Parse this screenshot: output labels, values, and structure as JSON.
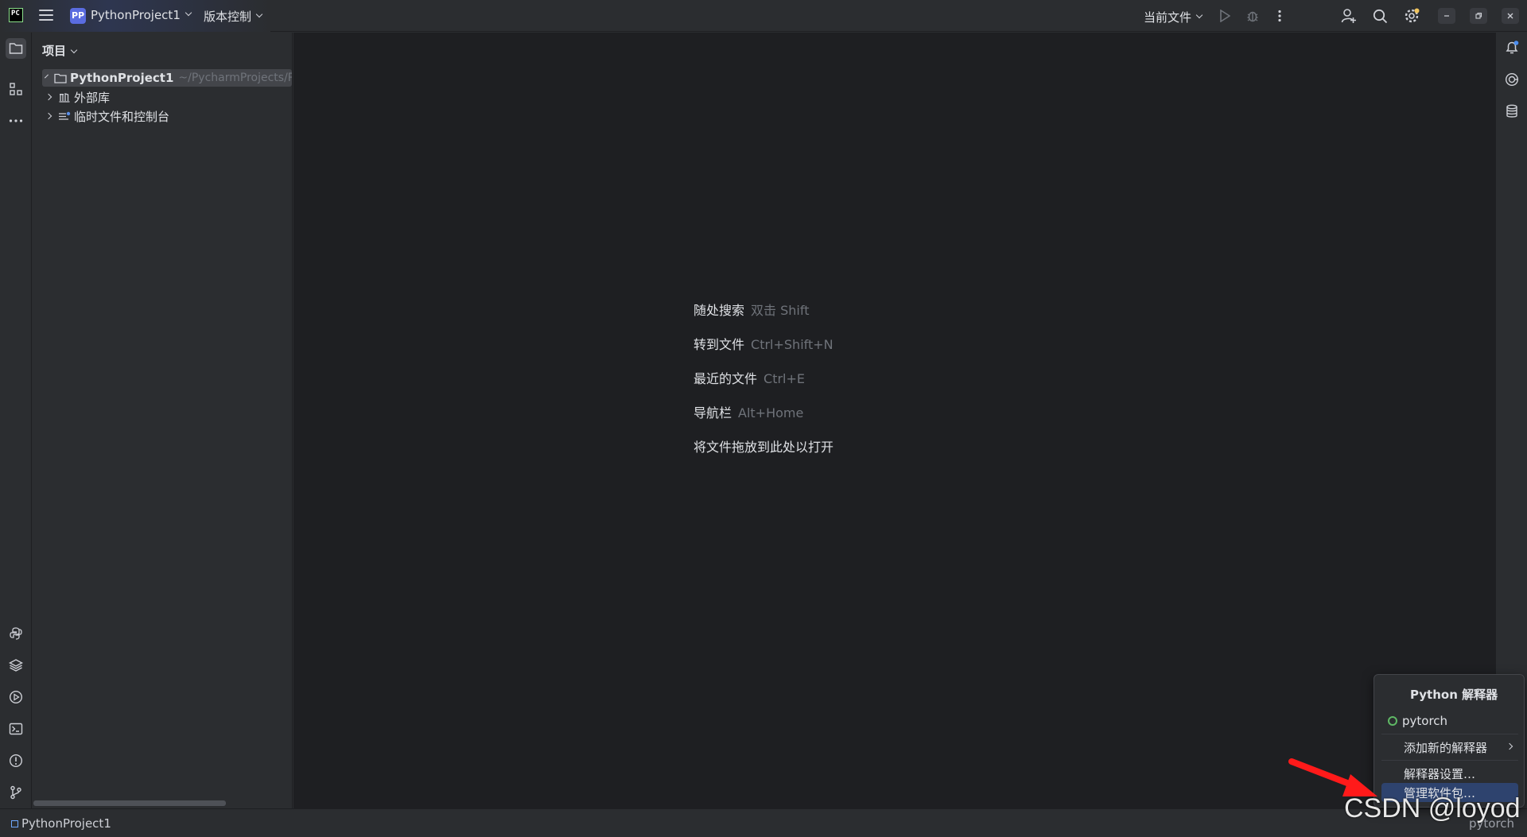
{
  "titlebar": {
    "app_icon": "pycharm-logo-icon",
    "project_badge": "PP",
    "project_name": "PythonProject1",
    "vcs_label": "版本控制",
    "run_config": "当前文件",
    "icons": [
      "menu-icon",
      "run-icon",
      "debug-icon",
      "more-vertical-icon",
      "add-user-icon",
      "search-icon",
      "settings-icon",
      "minimize-icon",
      "restore-icon",
      "close-icon"
    ]
  },
  "left_strip": {
    "top_icons": [
      "project-folder-icon",
      "structure-icon",
      "more-horizontal-icon"
    ],
    "bottom_icons": [
      "python-console-icon",
      "layers-icon",
      "services-icon",
      "terminal-icon",
      "problems-icon",
      "git-icon"
    ]
  },
  "project_panel": {
    "title": "项目",
    "tree": [
      {
        "label": "PythonProject1",
        "hint": "~/PycharmProjects/Py",
        "icon": "folder-icon",
        "expanded": true
      },
      {
        "label": "外部库",
        "icon": "library-icon",
        "expanded": false
      },
      {
        "label": "临时文件和控制台",
        "icon": "scratch-icon",
        "expanded": false
      }
    ]
  },
  "editor": {
    "hints": [
      {
        "label": "随处搜索",
        "key": "双击 Shift"
      },
      {
        "label": "转到文件",
        "key": "Ctrl+Shift+N"
      },
      {
        "label": "最近的文件",
        "key": "Ctrl+E"
      },
      {
        "label": "导航栏",
        "key": "Alt+Home"
      },
      {
        "label": "将文件拖放到此处以打开",
        "key": ""
      }
    ]
  },
  "right_strip": {
    "icons": [
      "notifications-icon",
      "ai-assistant-icon",
      "database-icon"
    ]
  },
  "statusbar": {
    "project": "PythonProject1",
    "interpreter": "pytorch"
  },
  "popup": {
    "title": "Python 解释器",
    "items": [
      {
        "label": "pytorch"
      },
      {
        "label": "添加新的解释器"
      },
      {
        "label": "解释器设置…"
      },
      {
        "label": "管理软件包…"
      }
    ],
    "selected_index": 3
  },
  "watermark": "CSDN @loyod",
  "colors": {
    "background": "#2b2d30",
    "editor_bg": "#1e1f22",
    "selection": "#2e436e",
    "accent_badge": "#5a6ce0",
    "arrow": "#ff1a1a"
  }
}
